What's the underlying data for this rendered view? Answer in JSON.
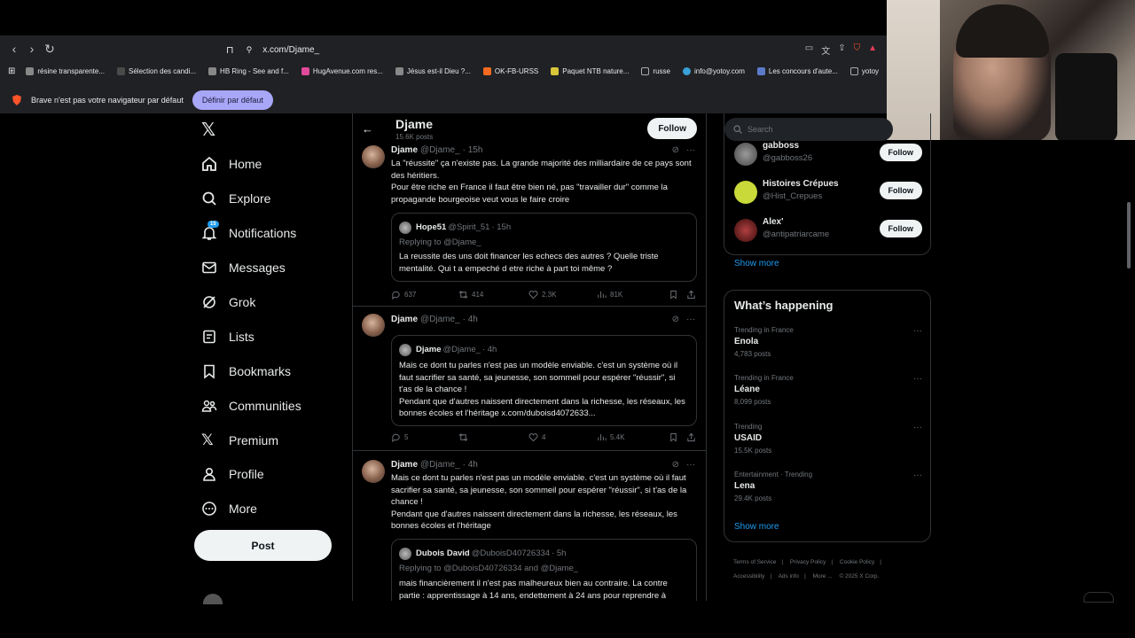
{
  "browser": {
    "url": "x.com/Djame_",
    "bookmarks": [
      {
        "label": "résine transparente...",
        "color": "#888"
      },
      {
        "label": "Sélection des candi...",
        "color": "#4a4a4a"
      },
      {
        "label": "HB Ring - See and f...",
        "color": "#888"
      },
      {
        "label": "HugAvenue.com res...",
        "color": "#e04a9a"
      },
      {
        "label": "Jésus est-il Dieu ?...",
        "color": "#888"
      },
      {
        "label": "OK-FB-URSS",
        "color": "#f26b21"
      },
      {
        "label": "Paquet NTB nature...",
        "color": "#d8c53a"
      },
      {
        "label": "russe",
        "color": "#888"
      },
      {
        "label": "info@yotoy.com",
        "color": "#3aa0d8"
      },
      {
        "label": "Les concours d'aute...",
        "color": "#5b7ac9"
      },
      {
        "label": "yotoy",
        "color": "#888"
      }
    ],
    "default_message": "Brave n'est pas votre navigateur par défaut",
    "default_button": "Définir par défaut"
  },
  "nav": {
    "items": [
      {
        "label": "Home",
        "icon": "home-icon"
      },
      {
        "label": "Explore",
        "icon": "search-icon"
      },
      {
        "label": "Notifications",
        "icon": "bell-icon",
        "badge": "15"
      },
      {
        "label": "Messages",
        "icon": "envelope-icon"
      },
      {
        "label": "Grok",
        "icon": "grok-icon"
      },
      {
        "label": "Lists",
        "icon": "list-icon"
      },
      {
        "label": "Bookmarks",
        "icon": "bookmark-icon"
      },
      {
        "label": "Communities",
        "icon": "communities-icon"
      },
      {
        "label": "Premium",
        "icon": "x-premium-icon"
      },
      {
        "label": "Profile",
        "icon": "person-icon"
      },
      {
        "label": "More",
        "icon": "more-circle-icon"
      }
    ],
    "post_label": "Post"
  },
  "profile_header": {
    "name": "Djame",
    "posts": "15.6K posts",
    "follow": "Follow"
  },
  "tweets": [
    {
      "name": "Djame",
      "handle": "@Djame_",
      "time": "· 15h",
      "text": "La \"réussite\" ça n'existe pas. La grande majorité des milliardaire de ce pays sont des héritiers.\nPour être riche en France il faut être bien né, pas \"travailler dur\" comme la propagande bourgeoise veut vous le faire croire",
      "quote": {
        "name": "Hope51",
        "handle": "@Spirit_51",
        "time": "· 15h",
        "reply": "Replying to @Djame_",
        "text": "La reussite des uns doit financer les echecs des autres ? Quelle triste mentalité. Qui t a empeché d etre riche à part toi même ?"
      },
      "stats": {
        "replies": "637",
        "reposts": "414",
        "likes": "2.3K",
        "views": "81K"
      }
    },
    {
      "name": "Djame",
      "handle": "@Djame_",
      "time": "· 4h",
      "quote": {
        "name": "Djame",
        "handle": "@Djame_",
        "time": "· 4h",
        "text": "Mais ce dont tu parles n'est pas un modèle enviable. c'est un système où il faut sacrifier sa santé, sa jeunesse, son sommeil pour espérer \"réussir\", si t'as de la chance !\nPendant que d'autres naissent directement dans la richesse, les réseaux, les bonnes écoles et l'héritage x.com/duboisd4072633..."
      },
      "stats": {
        "replies": "5",
        "reposts": "",
        "likes": "4",
        "views": "5.4K"
      }
    },
    {
      "name": "Djame",
      "handle": "@Djame_",
      "time": "· 4h",
      "text": "Mais ce dont tu parles n'est pas un modèle enviable. c'est un système où il faut sacrifier sa santé, sa jeunesse, son sommeil pour espérer \"réussir\", si t'as de la chance !\nPendant que d'autres naissent directement dans la richesse, les réseaux, les bonnes écoles et l'héritage",
      "quote": {
        "name": "Dubois David",
        "handle": "@DuboisD40726334",
        "time": "· 5h",
        "reply": "Replying to @DuboisD40726334 and @Djame_",
        "text": "mais financièrement il n'est pas malheureux bien au contraire. La contre partie : apprentissage à 14 ans, endettement à 24 ans pour reprendre à"
      }
    }
  ],
  "search": {
    "placeholder": "Search"
  },
  "who_to_follow": {
    "users": [
      {
        "name": "gabboss",
        "handle": "@gabboss26",
        "follow": "Follow",
        "color": "#6b6b6b"
      },
      {
        "name": "Histoires Crépues",
        "handle": "@Hist_Crepues",
        "follow": "Follow",
        "color": "#c9d93a"
      },
      {
        "name": "Alex'",
        "handle": "@antipatriarcame",
        "follow": "Follow",
        "color": "#7a1d1d"
      }
    ],
    "show_more": "Show more"
  },
  "happening": {
    "title": "What’s happening",
    "trends": [
      {
        "category": "Trending in France",
        "name": "Enola",
        "count": "4,783 posts"
      },
      {
        "category": "Trending in France",
        "name": "Léane",
        "count": "8,099 posts"
      },
      {
        "category": "Trending",
        "name": "USAID",
        "count": "15.5K posts"
      },
      {
        "category": "Entertainment · Trending",
        "name": "Lena",
        "count": "29.4K posts"
      }
    ],
    "show_more": "Show more"
  },
  "footer": {
    "links": [
      "Terms of Service",
      "|",
      "Privacy Policy",
      "|",
      "Cookie Policy",
      "|",
      "Accessibility",
      "|",
      "Ads info",
      "|",
      "More ...",
      "© 2025 X Corp."
    ]
  },
  "colors": {
    "accent": "#1d9bf0",
    "background": "#000000",
    "border": "#2f3336",
    "muted": "#71767b"
  }
}
